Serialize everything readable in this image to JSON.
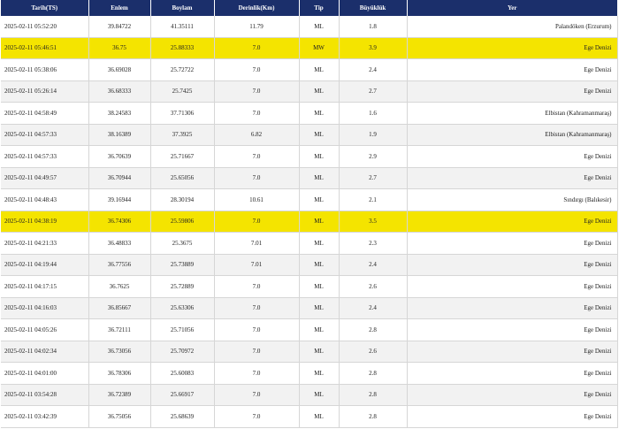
{
  "table": {
    "headers": [
      "Tarih(TS)",
      "Enlem",
      "Boylam",
      "Derinlik(Km)",
      "Tip",
      "Büyüklük",
      "Yer"
    ],
    "highlight_color": "#f4e400",
    "header_color": "#1b2f6b",
    "rows": [
      {
        "date": "2025-02-11 05:52:20",
        "lat": "39.84722",
        "lon": "41.35111",
        "depth": "11.79",
        "type": "ML",
        "mag": "1.8",
        "place": "Palandöken (Erzurum)",
        "highlight": false
      },
      {
        "date": "2025-02-11 05:46:51",
        "lat": "36.75",
        "lon": "25.88333",
        "depth": "7.0",
        "type": "MW",
        "mag": "3.9",
        "place": "Ege Denizi",
        "highlight": true
      },
      {
        "date": "2025-02-11 05:38:06",
        "lat": "36.69028",
        "lon": "25.72722",
        "depth": "7.0",
        "type": "ML",
        "mag": "2.4",
        "place": "Ege Denizi",
        "highlight": false
      },
      {
        "date": "2025-02-11 05:26:14",
        "lat": "36.68333",
        "lon": "25.7425",
        "depth": "7.0",
        "type": "ML",
        "mag": "2.7",
        "place": "Ege Denizi",
        "highlight": false
      },
      {
        "date": "2025-02-11 04:58:49",
        "lat": "38.24583",
        "lon": "37.71306",
        "depth": "7.0",
        "type": "ML",
        "mag": "1.6",
        "place": "Elbistan (Kahramanmaraş)",
        "highlight": false
      },
      {
        "date": "2025-02-11 04:57:33",
        "lat": "38.16389",
        "lon": "37.3925",
        "depth": "6.82",
        "type": "ML",
        "mag": "1.9",
        "place": "Elbistan (Kahramanmaraş)",
        "highlight": false
      },
      {
        "date": "2025-02-11 04:57:33",
        "lat": "36.70639",
        "lon": "25.71667",
        "depth": "7.0",
        "type": "ML",
        "mag": "2.9",
        "place": "Ege Denizi",
        "highlight": false
      },
      {
        "date": "2025-02-11 04:49:57",
        "lat": "36.70944",
        "lon": "25.65056",
        "depth": "7.0",
        "type": "ML",
        "mag": "2.7",
        "place": "Ege Denizi",
        "highlight": false
      },
      {
        "date": "2025-02-11 04:48:43",
        "lat": "39.16944",
        "lon": "28.30194",
        "depth": "10.61",
        "type": "ML",
        "mag": "2.1",
        "place": "Sındırgı (Balıkesir)",
        "highlight": false
      },
      {
        "date": "2025-02-11 04:38:19",
        "lat": "36.74306",
        "lon": "25.59806",
        "depth": "7.0",
        "type": "ML",
        "mag": "3.5",
        "place": "Ege Denizi",
        "highlight": true
      },
      {
        "date": "2025-02-11 04:21:33",
        "lat": "36.48833",
        "lon": "25.3675",
        "depth": "7.01",
        "type": "ML",
        "mag": "2.3",
        "place": "Ege Denizi",
        "highlight": false
      },
      {
        "date": "2025-02-11 04:19:44",
        "lat": "36.77556",
        "lon": "25.73889",
        "depth": "7.01",
        "type": "ML",
        "mag": "2.4",
        "place": "Ege Denizi",
        "highlight": false
      },
      {
        "date": "2025-02-11 04:17:15",
        "lat": "36.7625",
        "lon": "25.72889",
        "depth": "7.0",
        "type": "ML",
        "mag": "2.6",
        "place": "Ege Denizi",
        "highlight": false
      },
      {
        "date": "2025-02-11 04:16:03",
        "lat": "36.85667",
        "lon": "25.63306",
        "depth": "7.0",
        "type": "ML",
        "mag": "2.4",
        "place": "Ege Denizi",
        "highlight": false
      },
      {
        "date": "2025-02-11 04:05:26",
        "lat": "36.72111",
        "lon": "25.71056",
        "depth": "7.0",
        "type": "ML",
        "mag": "2.8",
        "place": "Ege Denizi",
        "highlight": false
      },
      {
        "date": "2025-02-11 04:02:34",
        "lat": "36.73056",
        "lon": "25.70972",
        "depth": "7.0",
        "type": "ML",
        "mag": "2.6",
        "place": "Ege Denizi",
        "highlight": false
      },
      {
        "date": "2025-02-11 04:01:00",
        "lat": "36.78306",
        "lon": "25.60083",
        "depth": "7.0",
        "type": "ML",
        "mag": "2.8",
        "place": "Ege Denizi",
        "highlight": false
      },
      {
        "date": "2025-02-11 03:54:28",
        "lat": "36.72389",
        "lon": "25.66917",
        "depth": "7.0",
        "type": "ML",
        "mag": "2.8",
        "place": "Ege Denizi",
        "highlight": false
      },
      {
        "date": "2025-02-11 03:42:39",
        "lat": "36.75056",
        "lon": "25.68639",
        "depth": "7.0",
        "type": "ML",
        "mag": "2.8",
        "place": "Ege Denizi",
        "highlight": false
      }
    ]
  }
}
